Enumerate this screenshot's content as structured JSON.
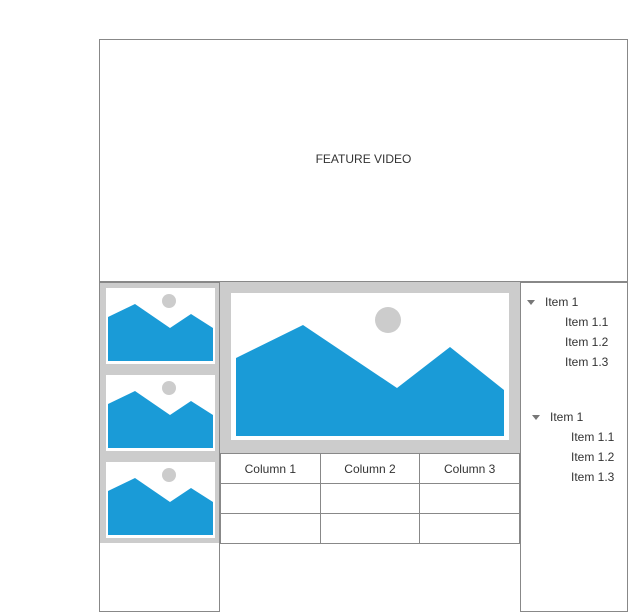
{
  "feature": {
    "label": "FEATURE VIDEO"
  },
  "icons": {
    "thumbnail": "image-placeholder-icon",
    "main_image": "image-placeholder-icon",
    "tree_toggle": "caret-down-icon"
  },
  "colors": {
    "image_mountain": "#1a9bd7",
    "image_sun": "#cccccc",
    "panel_background": "#cccccc",
    "border": "#888888"
  },
  "table": {
    "headers": [
      "Column 1",
      "Column 2",
      "Column 3"
    ],
    "rows": [
      [
        "",
        "",
        ""
      ],
      [
        "",
        "",
        ""
      ]
    ]
  },
  "tree": [
    {
      "label": "Item 1",
      "children": [
        "Item 1.1",
        "Item 1.2",
        "Item 1.3"
      ]
    },
    {
      "label": "Item 1",
      "children": [
        "Item 1.1",
        "Item 1.2",
        "Item 1.3"
      ]
    }
  ]
}
